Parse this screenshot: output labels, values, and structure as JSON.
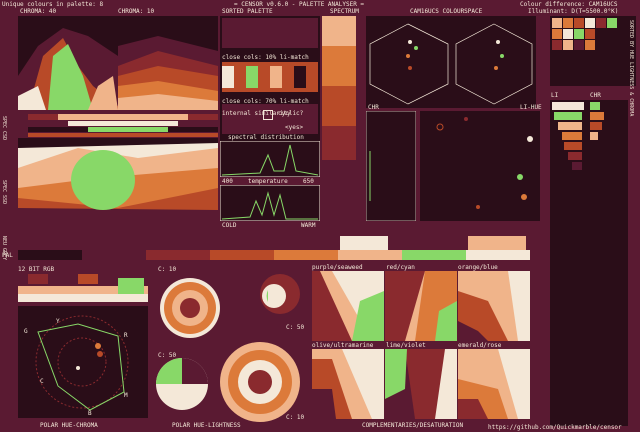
{
  "header": {
    "unique_colours": "Unique colours in palette: 8",
    "chroma": "CHROMA: 10",
    "sorted_palette": "SORTED PALETTE",
    "title": "= CENSOR v0.6.0 - PALETTE ANALYSER =",
    "colour_diff": "Colour difference: CAM16UCS",
    "illuminant": "Illuminant: D(T=5500.0°K)",
    "spectrum": "SPECTRUM",
    "cam16_space": "CAM16UCS COLOURSPACE"
  },
  "left": {
    "chroma_label": "CHROMA: 40",
    "spec_csd": "SPEC CSD",
    "spec_ssd": "SPEC SSD",
    "neu_grey": "NEU GREY",
    "pal": "PAL",
    "bit_rgb": "12 BIT RGB",
    "polar_hue_chroma": "POLAR HUE-CHROMA",
    "hue_letters": [
      "G",
      "Y",
      "R",
      "C",
      "M",
      "B"
    ]
  },
  "center": {
    "close_cols_1": "close cols: 10% li-match",
    "close_cols_2": "close cols: 70% li-match",
    "internal_similarity": "internal similarity",
    "cyclic": "cyclic?",
    "yes": "<yes>",
    "spectral_distribution": "spectral distribution",
    "spec_min": "400",
    "spec_max": "650",
    "temperature": "temperature",
    "cold": "COLD",
    "warm": "WARM",
    "c_labels": [
      "C: 10",
      "C: 50",
      "C: 50",
      "C: 10"
    ],
    "polar_hue_lightness": "POLAR HUE-LIGHTNESS"
  },
  "right": {
    "chr": "CHR",
    "li_hue": "LI-HUE",
    "li": "LI",
    "chr2": "CHR",
    "side_label": "SORTED BY HUE LIGHTNESS & CHROMA",
    "complementaries": "COMPLEMENTARIES/DESATURATION",
    "pairs": [
      "purple/seaweed",
      "red/cyan",
      "orange/blue",
      "olive/ultramarine",
      "lime/violet",
      "emerald/rose"
    ],
    "url": "https://github.com/Quickmarble/censor"
  },
  "palette": [
    "#2a0d18",
    "#5a1a32",
    "#8a2a2e",
    "#b84a28",
    "#dc7a3a",
    "#f0b48a",
    "#f4e8d8",
    "#88d868"
  ]
}
